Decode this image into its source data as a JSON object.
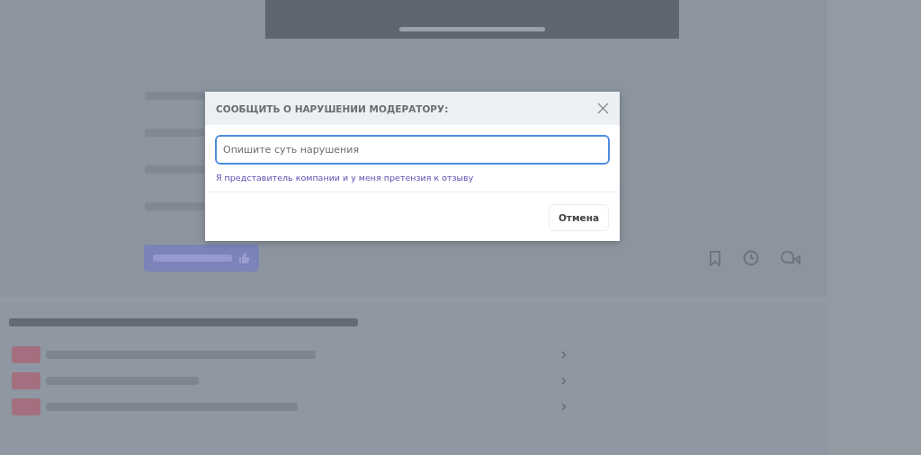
{
  "dialog": {
    "title": "СООБЩИТЬ О НАРУШЕНИИ МОДЕРАТОРУ:",
    "placeholder": "Опишите суть нарушения",
    "link": "Я представитель компании и у меня претензия к отзыву",
    "cancel": "Отмена"
  }
}
